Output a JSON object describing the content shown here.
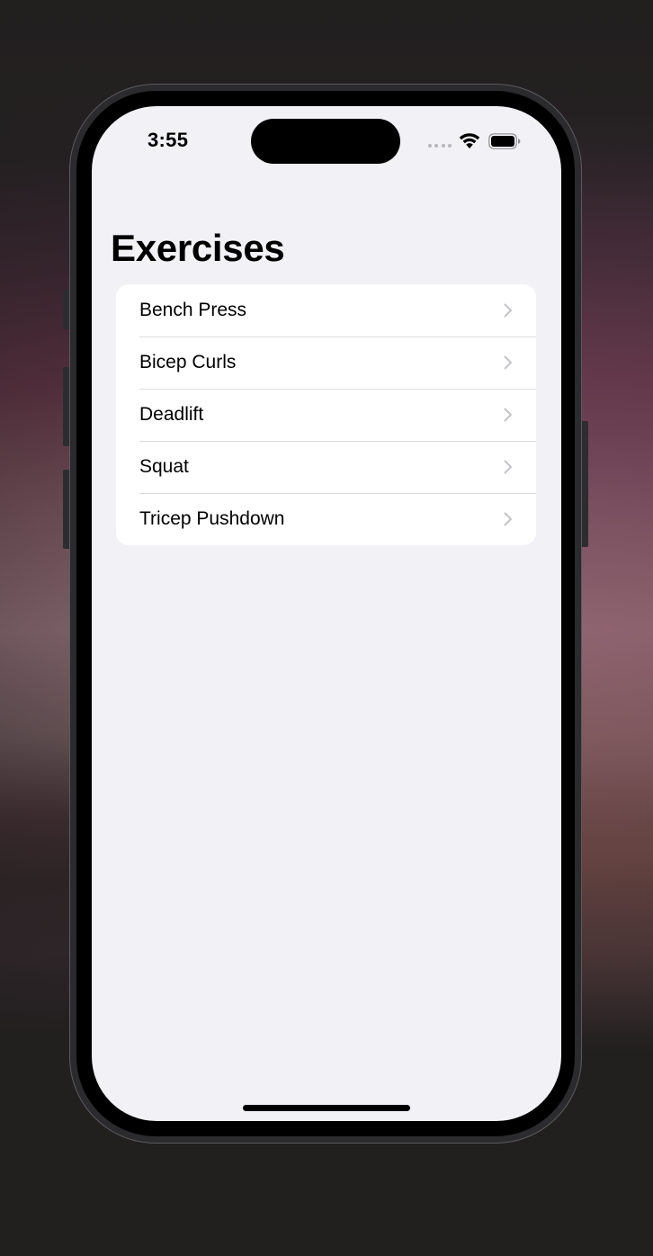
{
  "status_bar": {
    "time": "3:55",
    "icons": [
      "cellular-signal-icon",
      "wifi-icon",
      "battery-icon"
    ]
  },
  "nav": {
    "title": "Exercises"
  },
  "exercises": [
    {
      "label": "Bench Press"
    },
    {
      "label": "Bicep Curls"
    },
    {
      "label": "Deadlift"
    },
    {
      "label": "Squat"
    },
    {
      "label": "Tricep Pushdown"
    }
  ],
  "colors": {
    "background": "#f2f1f6",
    "list_background": "#ffffff",
    "separator": "#dcdce0",
    "chevron": "#c4c4c7",
    "text": "#000000"
  }
}
